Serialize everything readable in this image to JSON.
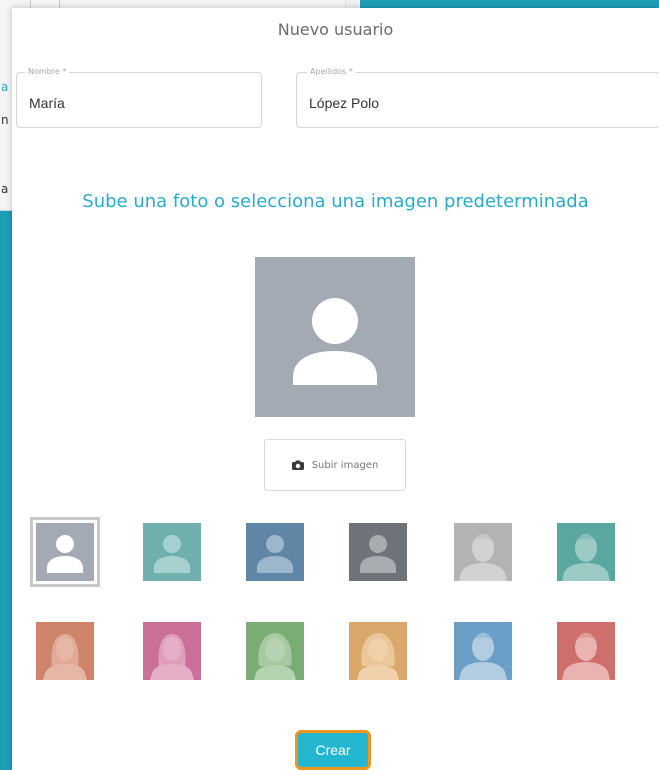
{
  "background": {
    "edge_letters": [
      "a",
      "n",
      "a"
    ]
  },
  "modal": {
    "title": "Nuevo usuario",
    "first_name": {
      "label": "Nombre *",
      "value": "María"
    },
    "last_name": {
      "label": "Apellidos *",
      "value": "López Polo"
    },
    "instruction": "Sube una foto o selecciona una imagen predeterminada",
    "upload_label": "Subir imagen",
    "upload_icon": "camera-icon",
    "create_label": "Crear"
  },
  "avatars": [
    {
      "name": "avatar-option-default-gray",
      "bg": "#a3aab3",
      "fg": "#ffffff",
      "style": "generic",
      "selected": true
    },
    {
      "name": "avatar-option-default-teal",
      "bg": "#6fb0ad",
      "fg": "#a7d1cf",
      "style": "generic",
      "selected": false
    },
    {
      "name": "avatar-option-default-blue",
      "bg": "#5f86a6",
      "fg": "#9cb6cb",
      "style": "generic",
      "selected": false
    },
    {
      "name": "avatar-option-default-dark",
      "bg": "#6e7379",
      "fg": "#a9adb1",
      "style": "generic",
      "selected": false
    },
    {
      "name": "avatar-option-man-gray",
      "bg": "#b3b3b3",
      "fg": "#d2d2d2",
      "style": "man",
      "selected": false
    },
    {
      "name": "avatar-option-man-teal",
      "bg": "#59a79f",
      "fg": "#9ccbc5",
      "style": "man",
      "selected": false
    },
    {
      "name": "avatar-option-woman-coral",
      "bg": "#cd8469",
      "fg": "#e6b7a6",
      "style": "woman",
      "selected": false
    },
    {
      "name": "avatar-option-woman-pink",
      "bg": "#c96f98",
      "fg": "#e6afc8",
      "style": "woman",
      "selected": false
    },
    {
      "name": "avatar-option-girl-green",
      "bg": "#79ad73",
      "fg": "#b6d3b1",
      "style": "girl",
      "selected": false
    },
    {
      "name": "avatar-option-girl-sand",
      "bg": "#d9a86a",
      "fg": "#efd0a8",
      "style": "girl",
      "selected": false
    },
    {
      "name": "avatar-option-boy-blue",
      "bg": "#6b9fc7",
      "fg": "#b2cde2",
      "style": "boy",
      "selected": false
    },
    {
      "name": "avatar-option-boy-red",
      "bg": "#cf6f6c",
      "fg": "#e9b3b1",
      "style": "boy",
      "selected": false
    }
  ]
}
